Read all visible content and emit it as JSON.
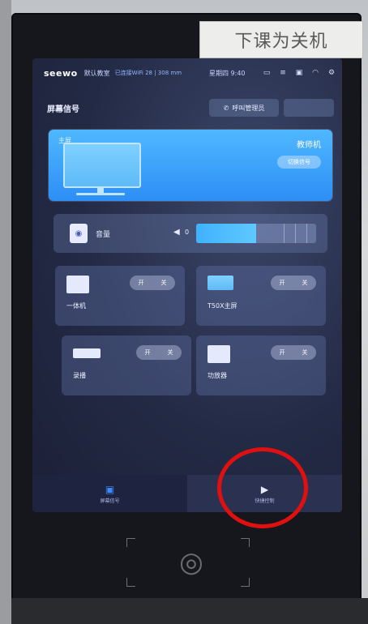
{
  "sticker": {
    "text": "下课为关机"
  },
  "statusbar": {
    "brand": "seewo",
    "mode": "默认教室",
    "info": "已连接WiFi 28 | 308 mm",
    "time": "星期四 9:40",
    "icons": [
      "screen-icon",
      "menu-icon",
      "display-icon",
      "wifi-icon",
      "settings-icon"
    ]
  },
  "header": {
    "section_title": "屏幕信号",
    "call_button": "呼叫管理员",
    "extra_button": ""
  },
  "signal": {
    "small_label": "主屏",
    "source_name": "教师机",
    "switch_label": "切换信号"
  },
  "volume": {
    "label": "音量",
    "value": "0",
    "level": 0.5
  },
  "devices": [
    {
      "name": "一体机",
      "on": "开",
      "off": "关",
      "icon": "all-in-one-icon"
    },
    {
      "name": "T50X主屏",
      "on": "开",
      "off": "关",
      "icon": "main-screen-icon"
    },
    {
      "name": "录播",
      "on": "开",
      "off": "关",
      "icon": "recorder-icon"
    },
    {
      "name": "功放器",
      "on": "开",
      "off": "关",
      "icon": "amplifier-icon"
    }
  ],
  "nav": [
    {
      "label": "屏幕信号",
      "icon": "screen-signal-icon",
      "active": true
    },
    {
      "label": "快捷控制",
      "icon": "quick-control-icon",
      "active": false
    }
  ],
  "colors": {
    "accent": "#2d8ef5",
    "highlight": "#e01010"
  }
}
